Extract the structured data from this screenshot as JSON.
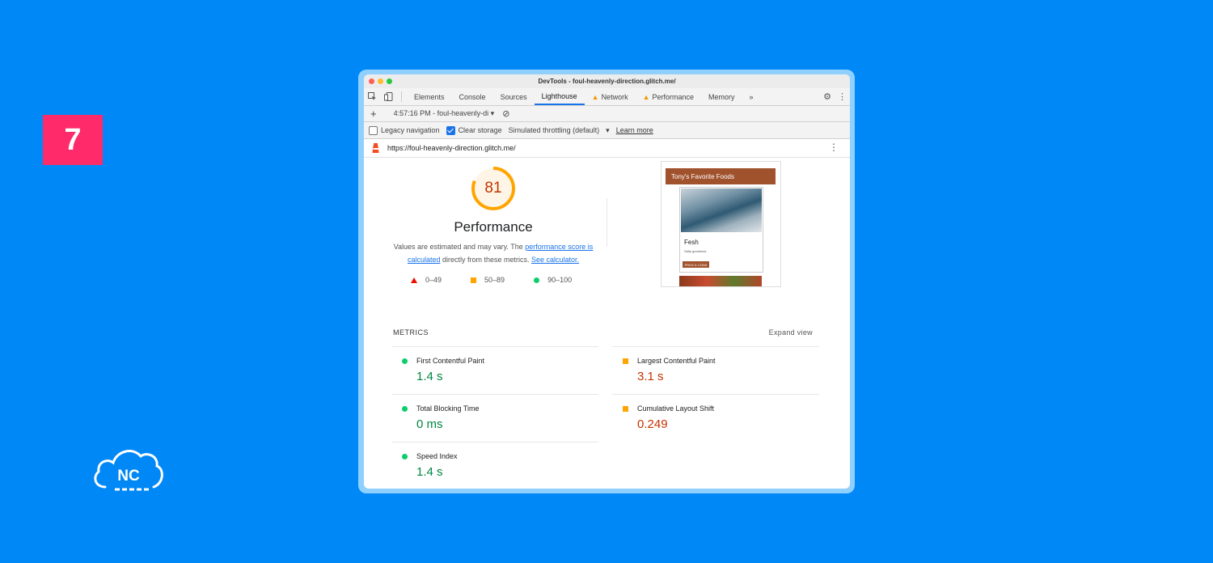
{
  "step": {
    "number": "7"
  },
  "brand": {
    "logo_text": "NC"
  },
  "window": {
    "title": "DevTools - foul-heavenly-direction.glitch.me/"
  },
  "tabs": [
    {
      "label": "Elements",
      "warning": false
    },
    {
      "label": "Console",
      "warning": false
    },
    {
      "label": "Sources",
      "warning": false
    },
    {
      "label": "Lighthouse",
      "warning": false,
      "active": true
    },
    {
      "label": "Network",
      "warning": true
    },
    {
      "label": "Performance",
      "warning": true
    },
    {
      "label": "Memory",
      "warning": false
    }
  ],
  "toolbar": {
    "add_icon": "plus-icon",
    "report_select": "4:57:16 PM - foul-heavenly-di",
    "clear_icon": "block-icon"
  },
  "options": {
    "legacy_navigation": {
      "label": "Legacy navigation",
      "checked": false
    },
    "clear_storage": {
      "label": "Clear storage",
      "checked": true
    },
    "throttling": "Simulated throttling (default)",
    "learn_more": "Learn more"
  },
  "url": "https://foul-heavenly-direction.glitch.me/",
  "score": {
    "value": 81,
    "value_text": "81",
    "title": "Performance",
    "desc_prefix": "Values are estimated and may vary. The ",
    "desc_link1": "performance score is calculated",
    "desc_mid": " directly from these metrics. ",
    "desc_link2": "See calculator."
  },
  "legend": [
    {
      "range": "0–49",
      "shape": "triangle",
      "color": "#eb0f00"
    },
    {
      "range": "50–89",
      "shape": "square",
      "color": "#ffa400"
    },
    {
      "range": "90–100",
      "shape": "circle",
      "color": "#0cce6b"
    }
  ],
  "screenshot": {
    "header": "Tony's Favorite Foods",
    "item_name": "Fesh",
    "item_sub": "Salty goodness",
    "item_button": "PROS & CONS"
  },
  "metrics": {
    "label": "METRICS",
    "expand": "Expand view",
    "items": [
      {
        "name": "First Contentful Paint",
        "value": "1.4 s",
        "rating": "good"
      },
      {
        "name": "Largest Contentful Paint",
        "value": "3.1 s",
        "rating": "average"
      },
      {
        "name": "Total Blocking Time",
        "value": "0 ms",
        "rating": "good"
      },
      {
        "name": "Cumulative Layout Shift",
        "value": "0.249",
        "rating": "average"
      },
      {
        "name": "Speed Index",
        "value": "1.4 s",
        "rating": "good"
      }
    ]
  },
  "colors": {
    "background": "#0088f7",
    "badge": "#ff2a6a",
    "score_orange": "#ffa400",
    "score_text": "#c33300",
    "good": "#018642",
    "link": "#1a73e8"
  }
}
